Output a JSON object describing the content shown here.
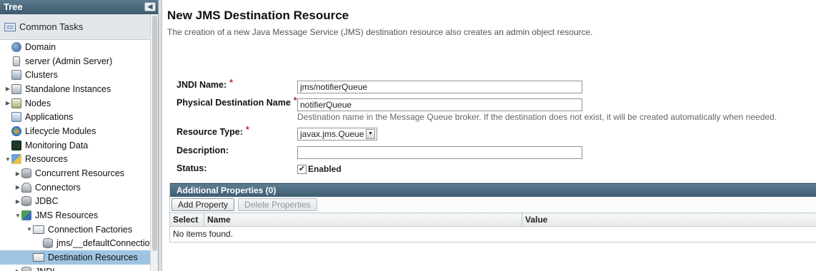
{
  "tree": {
    "header": "Tree",
    "collapse_glyph": "◀",
    "common_tasks": "Common Tasks",
    "items": [
      {
        "label": "Domain",
        "icon": "domain-icon",
        "indent": 0,
        "twisty": ""
      },
      {
        "label": "server (Admin Server)",
        "icon": "server-icon",
        "indent": 0,
        "twisty": ""
      },
      {
        "label": "Clusters",
        "icon": "clusters-icon",
        "indent": 0,
        "twisty": ""
      },
      {
        "label": "Standalone Instances",
        "icon": "instances-icon",
        "indent": 0,
        "twisty": "▶"
      },
      {
        "label": "Nodes",
        "icon": "nodes-icon",
        "indent": 0,
        "twisty": "▶"
      },
      {
        "label": "Applications",
        "icon": "applications-icon",
        "indent": 0,
        "twisty": ""
      },
      {
        "label": "Lifecycle Modules",
        "icon": "lifecycle-icon",
        "indent": 0,
        "twisty": ""
      },
      {
        "label": "Monitoring Data",
        "icon": "monitor-icon",
        "indent": 0,
        "twisty": ""
      },
      {
        "label": "Resources",
        "icon": "resources-icon",
        "indent": 0,
        "twisty": "▼"
      },
      {
        "label": "Concurrent Resources",
        "icon": "database-icon",
        "indent": 1,
        "twisty": "▶"
      },
      {
        "label": "Connectors",
        "icon": "connectors-icon",
        "indent": 1,
        "twisty": "▶"
      },
      {
        "label": "JDBC",
        "icon": "database-icon",
        "indent": 1,
        "twisty": "▶"
      },
      {
        "label": "JMS Resources",
        "icon": "jms-icon",
        "indent": 1,
        "twisty": "▼"
      },
      {
        "label": "Connection Factories",
        "icon": "folder-icon",
        "indent": 2,
        "twisty": "▼"
      },
      {
        "label": "jms/__defaultConnectionFactory",
        "icon": "database-icon",
        "indent": 3,
        "twisty": ""
      },
      {
        "label": "Destination Resources",
        "icon": "folder-icon",
        "indent": 2,
        "twisty": "",
        "selected": true
      },
      {
        "label": "JNDI",
        "icon": "database-icon",
        "indent": 1,
        "twisty": "▶"
      }
    ]
  },
  "page": {
    "title": "New JMS Destination Resource",
    "description": "The creation of a new Java Message Service (JMS) destination resource also creates an admin object resource."
  },
  "form": {
    "jndi_label": "JNDI Name:",
    "jndi_value": "jms/notifierQueue",
    "physical_label": "Physical Destination Name",
    "physical_value": "notifierQueue",
    "physical_help": "Destination name in the Message Queue broker. If the destination does not exist, it will be created automatically when needed.",
    "type_label": "Resource Type:",
    "type_value": "javax.jms.Queue",
    "description_label": "Description:",
    "description_value": "",
    "status_label": "Status:",
    "status_checked": true,
    "status_check_glyph": "✔",
    "status_option": "Enabled",
    "required_marker": "*"
  },
  "properties": {
    "header": "Additional Properties (0)",
    "add_button": "Add Property",
    "delete_button": "Delete Properties",
    "columns": [
      "Select",
      "Name",
      "Value"
    ],
    "empty_text": "No items found."
  },
  "colors": {
    "header_bar": "#3f5d72",
    "selection": "#9fc4e1",
    "required": "#c62828"
  }
}
